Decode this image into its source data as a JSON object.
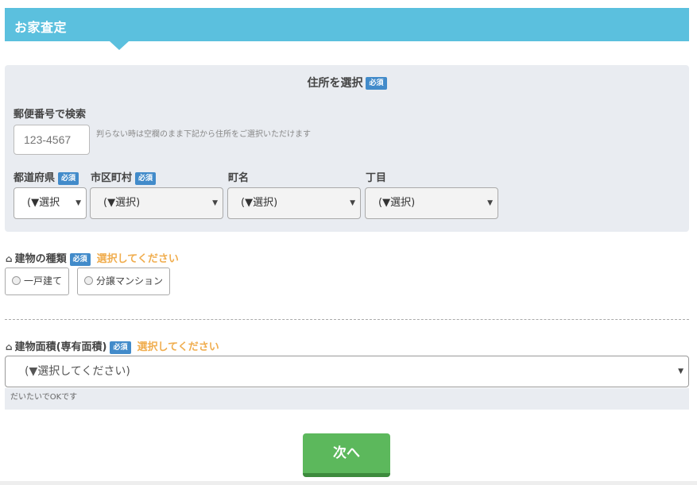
{
  "header": {
    "title": "お家査定"
  },
  "address": {
    "title": "住所を選択",
    "required": "必須",
    "zip_label": "郵便番号で検索",
    "zip_placeholder": "123-4567",
    "zip_hint": "判らない時は空欄のまま下記から住所をご選択いただけます",
    "prefecture_label": "都道府県",
    "city_label": "市区町村",
    "town_label": "町名",
    "chome_label": "丁目",
    "prefecture_value": "(▼選択",
    "city_value": "(▼選択)",
    "town_value": "(▼選択)",
    "chome_value": "(▼選択)"
  },
  "building_type": {
    "label": "建物の種類",
    "required": "必須",
    "warning": "選択してください",
    "options": [
      "一戸建て",
      "分譲マンション"
    ]
  },
  "building_area": {
    "label": "建物面積(専有面積)",
    "required": "必須",
    "warning": "選択してください",
    "placeholder": "(▼選択してください)",
    "note": "だいたいでOKです"
  },
  "next_button": "次へ",
  "icons": {
    "caret": "▼",
    "home": "home-icon"
  },
  "colors": {
    "header": "#5bc0de",
    "badge": "#428bca",
    "warning": "#f0ad4e",
    "next": "#5cb85c"
  }
}
